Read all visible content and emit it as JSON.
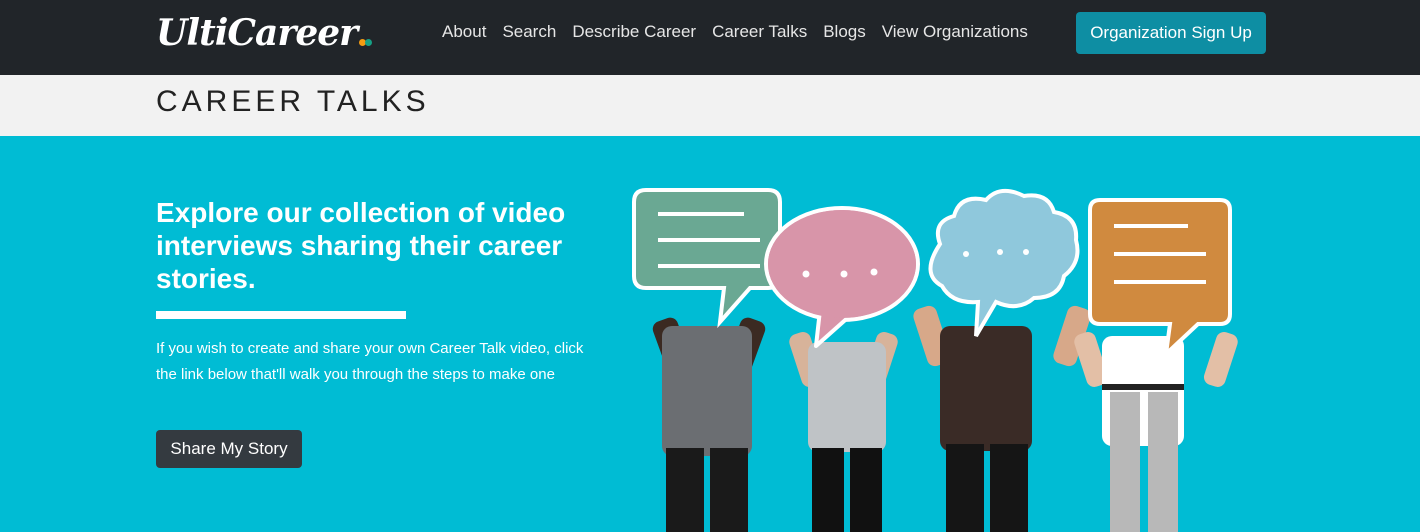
{
  "brand": {
    "name": "UltiCareer",
    "dot_colors": [
      "#f39c12",
      "#16a085"
    ]
  },
  "nav": {
    "links": [
      "About",
      "Search",
      "Describe Career",
      "Career Talks",
      "Blogs",
      "View Organizations"
    ],
    "signup_label": "Organization Sign Up"
  },
  "page": {
    "title": "CAREER TALKS"
  },
  "hero": {
    "heading": "Explore our collection of video interviews sharing their career stories.",
    "body": "If you wish to create and share your own Career Talk video, click the link below that'll walk you through the steps to make one",
    "cta_label": "Share My Story"
  },
  "colors": {
    "navbar": "#212529",
    "hero_bg": "#00bcd4",
    "accent_button": "#0e8ea3",
    "dark_button": "#343a40",
    "bubble_green": "#6aa893",
    "bubble_pink": "#d895a9",
    "bubble_blue": "#8fc8dc",
    "bubble_orange": "#d08a3f"
  }
}
